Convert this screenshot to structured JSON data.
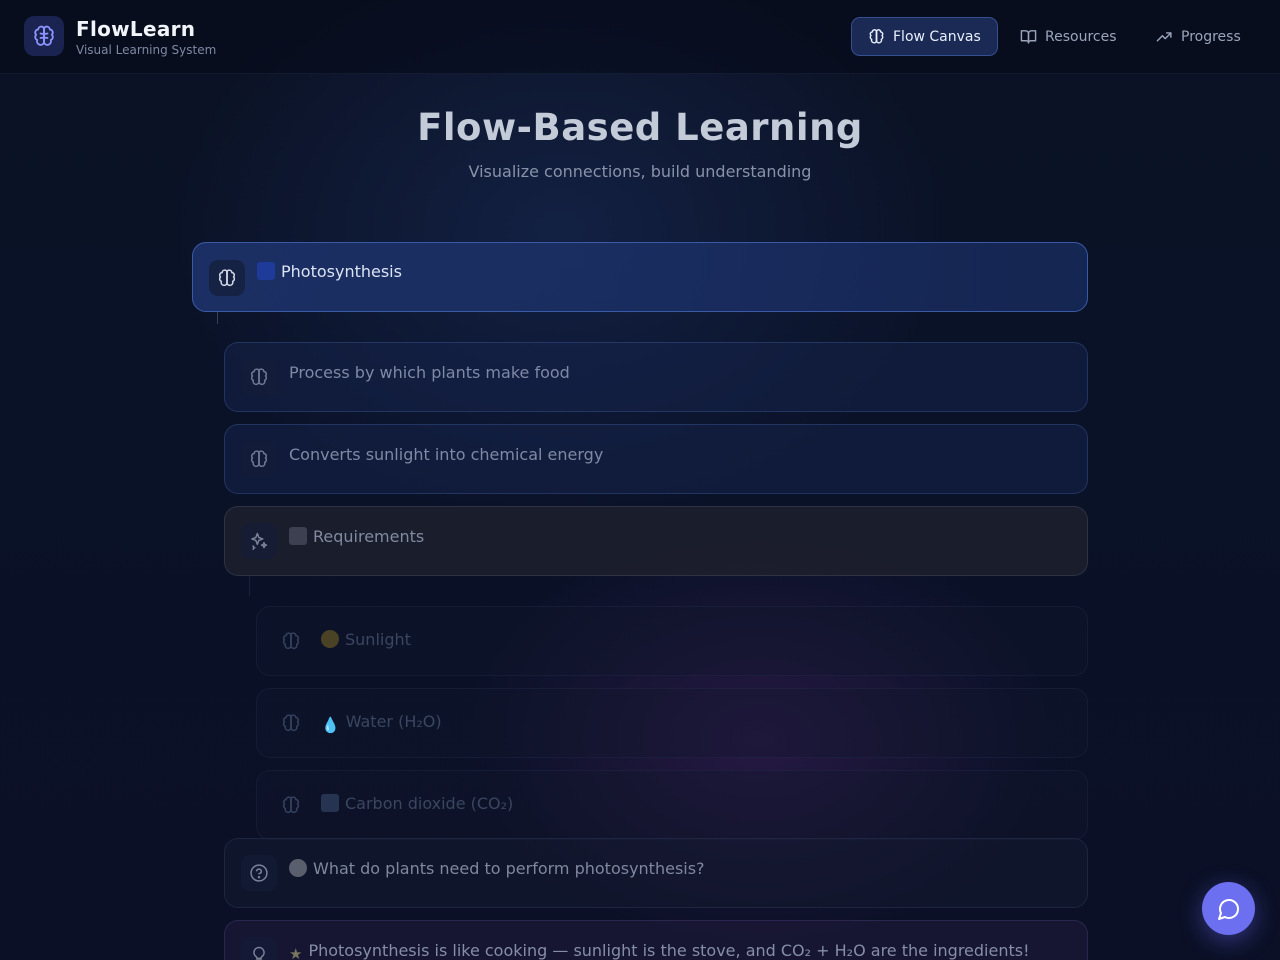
{
  "brand": {
    "title": "FlowLearn",
    "subtitle": "Visual Learning System",
    "icon": "brain-icon"
  },
  "nav": [
    {
      "label": "Flow Canvas",
      "icon": "brain-icon",
      "active": true
    },
    {
      "label": "Resources",
      "icon": "book-open-icon",
      "active": false
    },
    {
      "label": "Progress",
      "icon": "trending-up-icon",
      "active": false
    }
  ],
  "hero": {
    "title": "Flow-Based Learning",
    "subtitle": "Visualize connections, build understanding"
  },
  "nodes": {
    "root": {
      "label": "Photosynthesis",
      "icon": "brain-icon",
      "emoji": "🌌"
    },
    "def1": {
      "label": "Process by which plants make food",
      "icon": "brain-icon"
    },
    "def2": {
      "label": "Converts sunlight into chemical energy",
      "icon": "brain-icon"
    },
    "requirements": {
      "label": "Requirements",
      "icon": "sparkles-icon",
      "emoji": "⬛"
    },
    "req_items": [
      {
        "label": "Sunlight",
        "icon": "brain-icon",
        "emoji": "🌕"
      },
      {
        "label": "Water (H₂O)",
        "icon": "brain-icon",
        "emoji": "💧"
      },
      {
        "label": "Carbon dioxide (CO₂)",
        "icon": "brain-icon",
        "emoji": "🌬"
      }
    ],
    "quiz": {
      "label": "What do plants need to perform photosynthesis?",
      "icon": "help-circle-icon",
      "emoji": "🔘"
    },
    "analogy": {
      "label": "Photosynthesis is like cooking — sunlight is the stove, and CO₂ + H₂O are the ingredients!",
      "icon": "lightbulb-icon",
      "emoji": "⭐"
    }
  },
  "fab": {
    "icon": "chat-bubble-icon"
  },
  "colors": {
    "background": "#0b1224",
    "accent": "#6b6ff0",
    "active_nav": "#1a2a55",
    "root_card": "#1e346e"
  }
}
